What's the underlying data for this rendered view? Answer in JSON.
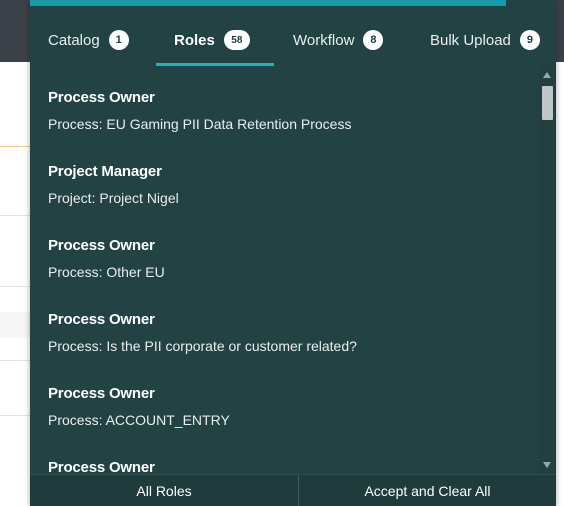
{
  "tabs": [
    {
      "label": "Catalog",
      "count": "1"
    },
    {
      "label": "Roles",
      "count": "58"
    },
    {
      "label": "Workflow",
      "count": "8"
    },
    {
      "label": "Bulk Upload",
      "count": "9"
    }
  ],
  "active_tab": "Roles",
  "items": [
    {
      "title": "Process Owner",
      "subtitle": "Process: EU Gaming PII Data Retention Process"
    },
    {
      "title": "Project Manager",
      "subtitle": "Project: Project Nigel"
    },
    {
      "title": "Process Owner",
      "subtitle": "Process: Other EU"
    },
    {
      "title": "Process Owner",
      "subtitle": "Process: Is the PII corporate or customer related?"
    },
    {
      "title": "Process Owner",
      "subtitle": "Process: ACCOUNT_ENTRY"
    },
    {
      "title": "Process Owner",
      "subtitle": ""
    }
  ],
  "footer": {
    "all_roles": "All Roles",
    "accept_clear": "Accept and Clear All"
  },
  "colors": {
    "panel_bg": "#234243",
    "accent": "#20b2bf",
    "footer_bg": "#1f3b3c"
  }
}
